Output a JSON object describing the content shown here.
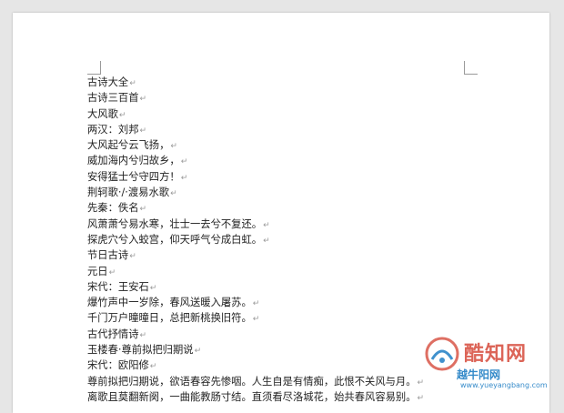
{
  "document": {
    "lines": [
      "古诗大全",
      "古诗三百首",
      "大风歌",
      "两汉：刘邦",
      "大风起兮云飞扬，",
      "威加海内兮归故乡，",
      "安得猛士兮守四方！",
      "荆轲歌·/·渡易水歌",
      "先秦：佚名",
      "风萧萧兮易水寒，壮士一去兮不复还。",
      "探虎穴兮入蛟宫，仰天呼气兮成白虹。",
      "节日古诗",
      "元日",
      "宋代：王安石",
      "爆竹声中一岁除，春风送暖入屠苏。",
      "千门万户曈曈日，总把新桃换旧符。",
      "古代抒情诗",
      "玉楼春·尊前拟把归期说",
      "宋代：欧阳修",
      "尊前拟把归期说，欲语春容先惨咽。人生自是有情痴，此恨不关风与月。",
      "离歌且莫翻新阕，一曲能教肠寸结。直须看尽洛城花，始共春风容易别。"
    ],
    "paragraph_mark": "↵"
  },
  "watermark": {
    "brand": "酷知网",
    "brand_secondary": "越牛阳网",
    "url": "www.yueyangbang.com",
    "colors": {
      "red": "#d64b3c",
      "blue": "#1f7ec4"
    }
  }
}
